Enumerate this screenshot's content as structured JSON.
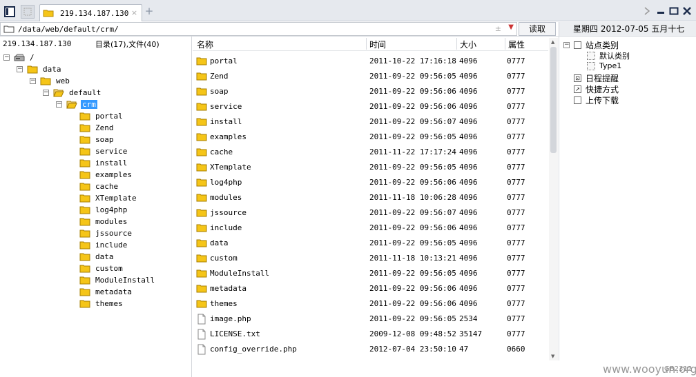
{
  "tab": {
    "title": "219.134.187.130"
  },
  "address": {
    "path": "/data/web/default/crm/",
    "read_label": "读取",
    "date": "星期四 2012-07-05 五月十七"
  },
  "left": {
    "ip": "219.134.187.130",
    "counts": "目录(17),文件(40)",
    "tree": [
      {
        "label": "/",
        "level": 0,
        "toggle": "−",
        "icon": "drive"
      },
      {
        "label": "data",
        "level": 1,
        "toggle": "−",
        "icon": "folder"
      },
      {
        "label": "web",
        "level": 2,
        "toggle": "−",
        "icon": "folder"
      },
      {
        "label": "default",
        "level": 3,
        "toggle": "−",
        "icon": "folder-open"
      },
      {
        "label": "crm",
        "level": 4,
        "toggle": "−",
        "icon": "folder-open",
        "selected": true
      },
      {
        "label": "portal",
        "level": 5,
        "icon": "folder"
      },
      {
        "label": "Zend",
        "level": 5,
        "icon": "folder"
      },
      {
        "label": "soap",
        "level": 5,
        "icon": "folder"
      },
      {
        "label": "service",
        "level": 5,
        "icon": "folder"
      },
      {
        "label": "install",
        "level": 5,
        "icon": "folder"
      },
      {
        "label": "examples",
        "level": 5,
        "icon": "folder"
      },
      {
        "label": "cache",
        "level": 5,
        "icon": "folder"
      },
      {
        "label": "XTemplate",
        "level": 5,
        "icon": "folder"
      },
      {
        "label": "log4php",
        "level": 5,
        "icon": "folder"
      },
      {
        "label": "modules",
        "level": 5,
        "icon": "folder"
      },
      {
        "label": "jssource",
        "level": 5,
        "icon": "folder"
      },
      {
        "label": "include",
        "level": 5,
        "icon": "folder"
      },
      {
        "label": "data",
        "level": 5,
        "icon": "folder"
      },
      {
        "label": "custom",
        "level": 5,
        "icon": "folder"
      },
      {
        "label": "ModuleInstall",
        "level": 5,
        "icon": "folder"
      },
      {
        "label": "metadata",
        "level": 5,
        "icon": "folder"
      },
      {
        "label": "themes",
        "level": 5,
        "icon": "folder"
      }
    ]
  },
  "table": {
    "headers": {
      "name": "名称",
      "time": "时间",
      "size": "大小",
      "attr": "属性"
    },
    "rows": [
      {
        "name": "portal",
        "time": "2011-10-22 17:16:18",
        "size": "4096",
        "attr": "0777",
        "icon": "folder"
      },
      {
        "name": "Zend",
        "time": "2011-09-22 09:56:05",
        "size": "4096",
        "attr": "0777",
        "icon": "folder"
      },
      {
        "name": "soap",
        "time": "2011-09-22 09:56:06",
        "size": "4096",
        "attr": "0777",
        "icon": "folder"
      },
      {
        "name": "service",
        "time": "2011-09-22 09:56:06",
        "size": "4096",
        "attr": "0777",
        "icon": "folder"
      },
      {
        "name": "install",
        "time": "2011-09-22 09:56:07",
        "size": "4096",
        "attr": "0777",
        "icon": "folder"
      },
      {
        "name": "examples",
        "time": "2011-09-22 09:56:05",
        "size": "4096",
        "attr": "0777",
        "icon": "folder"
      },
      {
        "name": "cache",
        "time": "2011-11-22 17:17:24",
        "size": "4096",
        "attr": "0777",
        "icon": "folder"
      },
      {
        "name": "XTemplate",
        "time": "2011-09-22 09:56:05",
        "size": "4096",
        "attr": "0777",
        "icon": "folder"
      },
      {
        "name": "log4php",
        "time": "2011-09-22 09:56:06",
        "size": "4096",
        "attr": "0777",
        "icon": "folder"
      },
      {
        "name": "modules",
        "time": "2011-11-18 10:06:28",
        "size": "4096",
        "attr": "0777",
        "icon": "folder"
      },
      {
        "name": "jssource",
        "time": "2011-09-22 09:56:07",
        "size": "4096",
        "attr": "0777",
        "icon": "folder"
      },
      {
        "name": "include",
        "time": "2011-09-22 09:56:06",
        "size": "4096",
        "attr": "0777",
        "icon": "folder"
      },
      {
        "name": "data",
        "time": "2011-09-22 09:56:05",
        "size": "4096",
        "attr": "0777",
        "icon": "folder"
      },
      {
        "name": "custom",
        "time": "2011-11-18 10:13:21",
        "size": "4096",
        "attr": "0777",
        "icon": "folder"
      },
      {
        "name": "ModuleInstall",
        "time": "2011-09-22 09:56:05",
        "size": "4096",
        "attr": "0777",
        "icon": "folder"
      },
      {
        "name": "metadata",
        "time": "2011-09-22 09:56:06",
        "size": "4096",
        "attr": "0777",
        "icon": "folder"
      },
      {
        "name": "themes",
        "time": "2011-09-22 09:56:06",
        "size": "4096",
        "attr": "0777",
        "icon": "folder"
      },
      {
        "name": "image.php",
        "time": "2011-09-22 09:56:05",
        "size": "2534",
        "attr": "0777",
        "icon": "file"
      },
      {
        "name": "LICENSE.txt",
        "time": "2009-12-08 09:48:52",
        "size": "35147",
        "attr": "0777",
        "icon": "file"
      },
      {
        "name": "config_override.php",
        "time": "2012-07-04 23:50:10",
        "size": "47",
        "attr": "0660",
        "icon": "file"
      }
    ]
  },
  "right": {
    "items": [
      {
        "label": "站点类别",
        "level": 0,
        "toggle": "−",
        "icon": "square"
      },
      {
        "label": "默认类别",
        "level": 1,
        "icon": "dotted-square"
      },
      {
        "label": "Type1",
        "level": 1,
        "icon": "dotted-square"
      },
      {
        "label": "日程提醒",
        "level": 0,
        "icon": "calendar"
      },
      {
        "label": "快捷方式",
        "level": 0,
        "icon": "shortcut"
      },
      {
        "label": "上传下载",
        "level": 0,
        "icon": "square"
      }
    ]
  },
  "watermark": {
    "text": "www.wooyun.org",
    "corner": "GB2312"
  },
  "colors": {
    "accent": "#3399ff",
    "folder": "#f5c518"
  }
}
